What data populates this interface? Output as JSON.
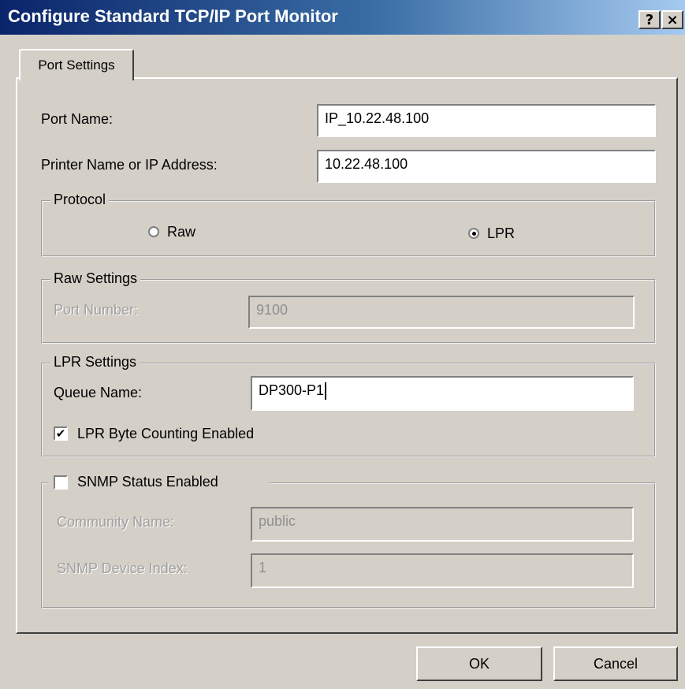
{
  "window": {
    "title": "Configure Standard TCP/IP Port Monitor",
    "help_button": "?",
    "close_button": "×"
  },
  "tabs": [
    {
      "label": "Port Settings",
      "selected": true
    }
  ],
  "port_name": {
    "label": "Port Name:",
    "value": "IP_10.22.48.100"
  },
  "printer_address": {
    "label": "Printer Name or IP Address:",
    "value": "10.22.48.100"
  },
  "protocol": {
    "legend": "Protocol",
    "options": [
      {
        "label": "Raw",
        "selected": false
      },
      {
        "label": "LPR",
        "selected": true
      }
    ]
  },
  "raw_settings": {
    "legend": "Raw Settings",
    "port_number_label": "Port Number:",
    "port_number_value": "9100"
  },
  "lpr_settings": {
    "legend": "LPR Settings",
    "queue_name_label": "Queue Name:",
    "queue_name_value": "DP300-P1",
    "byte_counting_label": "LPR Byte Counting Enabled",
    "byte_counting_checked": true
  },
  "snmp": {
    "label": "SNMP Status Enabled",
    "checked": false,
    "community_label": "Community Name:",
    "community_value": "public",
    "device_index_label": "SNMP Device Index:",
    "device_index_value": "1"
  },
  "buttons": {
    "ok": "OK",
    "cancel": "Cancel"
  },
  "icons": {
    "check_mark": "✔"
  }
}
